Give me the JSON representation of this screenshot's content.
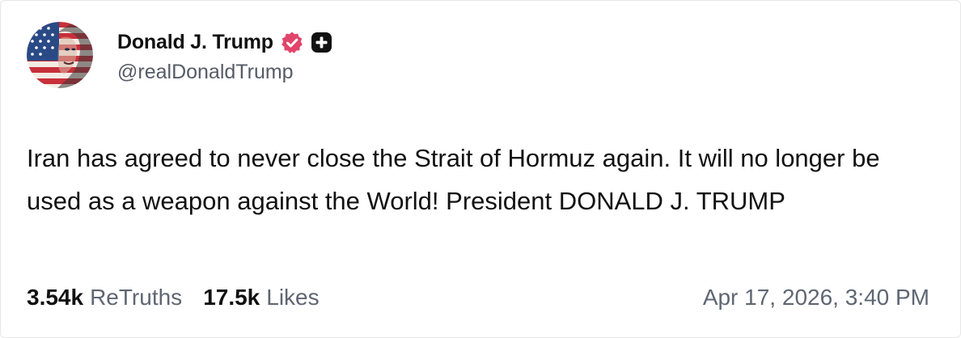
{
  "author": {
    "display_name": "Donald J. Trump",
    "handle": "@realDonaldTrump",
    "verified_icon": "verified-check-badge-icon",
    "verified_color": "#e2446b",
    "plus_badge_icon": "plus-badge-icon"
  },
  "post": {
    "text": "Iran has agreed to never close the Strait of Hormuz again. It will no longer be used as a weapon against the World! President DONALD J. TRUMP"
  },
  "stats": {
    "retruths_count": "3.54k",
    "retruths_label": "ReTruths",
    "likes_count": "17.5k",
    "likes_label": "Likes"
  },
  "timestamp": "Apr 17, 2026, 3:40 PM"
}
